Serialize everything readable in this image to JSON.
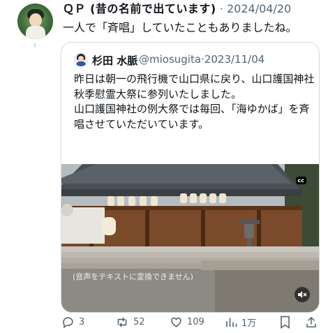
{
  "tweet": {
    "display_name": "ＱＰ (昔の名前で出ています)",
    "dot": "·",
    "date": "2024/04/20",
    "text": "一人で「斉唱」していたこともありましたね。"
  },
  "quote": {
    "display_name": "杉田 水脈",
    "handle": "@miosugita",
    "dot": "·",
    "date": "2023/11/04",
    "paragraph1": "昨日は朝一の飛行機で山口県に戻り、山口護国神社秋季慰霊大祭に参列いたしました。",
    "paragraph2": "山口護国神社の例大祭では毎回、「海ゆかば」を斉唱させていただいています。",
    "media": {
      "cc_label": "cc",
      "caption": "(音声をテキストに変換できません)",
      "mute_icon": "mute-icon"
    }
  },
  "actions": {
    "replies": "3",
    "reposts": "52",
    "likes": "109",
    "views": "1万"
  },
  "colors": {
    "muted": "#536471",
    "border": "#cfd9de"
  }
}
